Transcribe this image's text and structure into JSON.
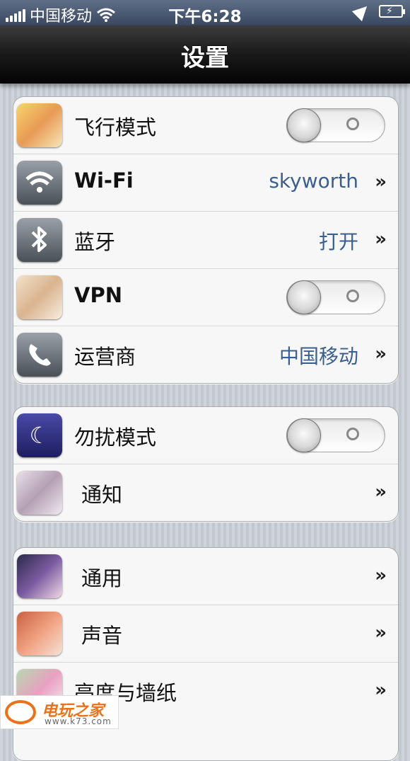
{
  "status_bar": {
    "carrier": "中国移动",
    "time": "下午6:28"
  },
  "nav": {
    "title": "设置"
  },
  "group1": [
    {
      "label": "飞行模式",
      "type": "toggle",
      "on": false,
      "icon": "avatar-anime-icon"
    },
    {
      "label": "Wi-Fi",
      "value": "skyworth",
      "type": "link",
      "icon": "wifi-icon"
    },
    {
      "label": "蓝牙",
      "value": "打开",
      "type": "link",
      "icon": "bluetooth-icon"
    },
    {
      "label": "VPN",
      "type": "toggle",
      "on": false,
      "icon": "avatar-anime-icon"
    },
    {
      "label": "运营商",
      "value": "中国移动",
      "type": "link",
      "icon": "phone-icon"
    }
  ],
  "group2": [
    {
      "label": "勿扰模式",
      "type": "toggle",
      "on": false,
      "icon": "moon-icon"
    },
    {
      "label": "通知",
      "type": "link",
      "icon": "avatar-anime-icon"
    }
  ],
  "group3": [
    {
      "label": "通用",
      "type": "link",
      "icon": "avatar-anime-icon"
    },
    {
      "label": "声音",
      "type": "link",
      "icon": "avatar-anime-icon"
    },
    {
      "label": "亮度与墙纸",
      "type": "link",
      "icon": "flower-icon"
    }
  ],
  "chevron": "»",
  "watermark": {
    "name": "电玩之家",
    "url": "www.k73.com"
  }
}
